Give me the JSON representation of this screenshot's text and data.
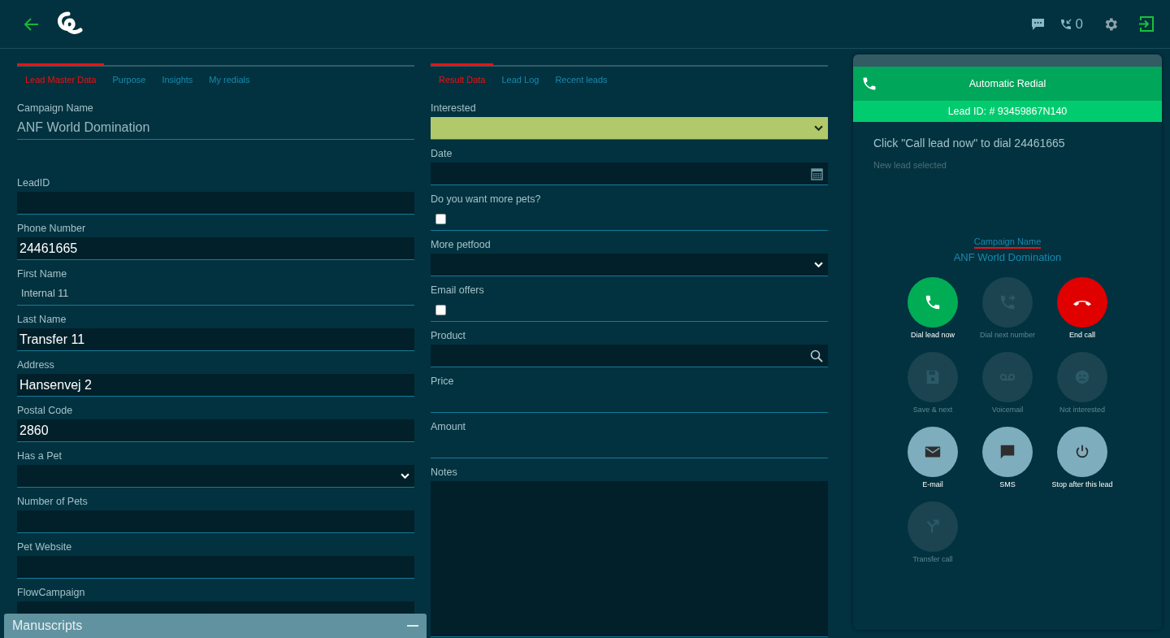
{
  "topbar": {
    "call_count": "0"
  },
  "left": {
    "tabs": [
      {
        "label": "Lead Master Data",
        "selected": true
      },
      {
        "label": "Purpose",
        "selected": false
      },
      {
        "label": "Insights",
        "selected": false
      },
      {
        "label": "My redials",
        "selected": false
      }
    ],
    "fields": [
      {
        "label": "Campaign Name",
        "kind": "readonly",
        "value": "ANF World Domination"
      },
      {
        "label": "LeadID",
        "kind": "text"
      },
      {
        "label": "Phone Number",
        "kind": "text",
        "value": "24461665"
      },
      {
        "label": "First Name",
        "kind": "static",
        "value": "Internal 11"
      },
      {
        "label": "Last Name",
        "kind": "text",
        "value": "Transfer 11"
      },
      {
        "label": "Address",
        "kind": "text",
        "value": "Hansenvej 2"
      },
      {
        "label": "Postal Code",
        "kind": "text",
        "value": "2860"
      },
      {
        "label": "Has a Pet",
        "kind": "select",
        "highlighted": false
      },
      {
        "label": "Number of Pets",
        "kind": "text"
      },
      {
        "label": "Pet Website",
        "kind": "text"
      },
      {
        "label": "FlowCampaign",
        "kind": "text"
      }
    ]
  },
  "middle": {
    "tabs": [
      {
        "label": "Result Data",
        "selected": true
      },
      {
        "label": "Lead Log",
        "selected": false
      },
      {
        "label": "Recent leads",
        "selected": false
      }
    ],
    "fields": [
      {
        "label": "Interested",
        "kind": "select",
        "highlighted": true
      },
      {
        "label": "Date",
        "kind": "date"
      },
      {
        "label": "Do you want more pets?",
        "kind": "checkbox",
        "checked": false
      },
      {
        "label": "More petfood",
        "kind": "select",
        "highlighted": false
      },
      {
        "label": "Email offers",
        "kind": "checkbox",
        "checked": false
      },
      {
        "label": "Product",
        "kind": "search"
      },
      {
        "label": "Price",
        "kind": "line"
      },
      {
        "label": "Amount",
        "kind": "line"
      },
      {
        "label": "Notes",
        "kind": "textarea"
      }
    ]
  },
  "dialer": {
    "title": "Automatic Redial",
    "lead_id": "Lead ID: # 93459867N140",
    "message": "Click \"Call lead now\" to dial 24461665",
    "status": "New lead selected",
    "campaign_label": "Campaign Name",
    "campaign_value": "ANF World Domination",
    "buttons": [
      {
        "label": "Dial lead now",
        "kind": "green",
        "disabled": false
      },
      {
        "label": "Dial next number",
        "kind": "action",
        "disabled": true
      },
      {
        "label": "End call",
        "kind": "red",
        "disabled": false
      },
      {
        "label": "Save & next",
        "kind": "action",
        "disabled": true
      },
      {
        "label": "Voicemail",
        "kind": "action",
        "disabled": true
      },
      {
        "label": "Not interested",
        "kind": "action",
        "disabled": true
      },
      {
        "label": "E-mail",
        "kind": "action",
        "disabled": false
      },
      {
        "label": "SMS",
        "kind": "action",
        "disabled": false
      },
      {
        "label": "Stop after this lead",
        "kind": "action",
        "disabled": false
      },
      {
        "label": "Transfer call",
        "kind": "action",
        "disabled": true
      }
    ]
  },
  "manuscripts": {
    "title": "Manuscripts"
  }
}
